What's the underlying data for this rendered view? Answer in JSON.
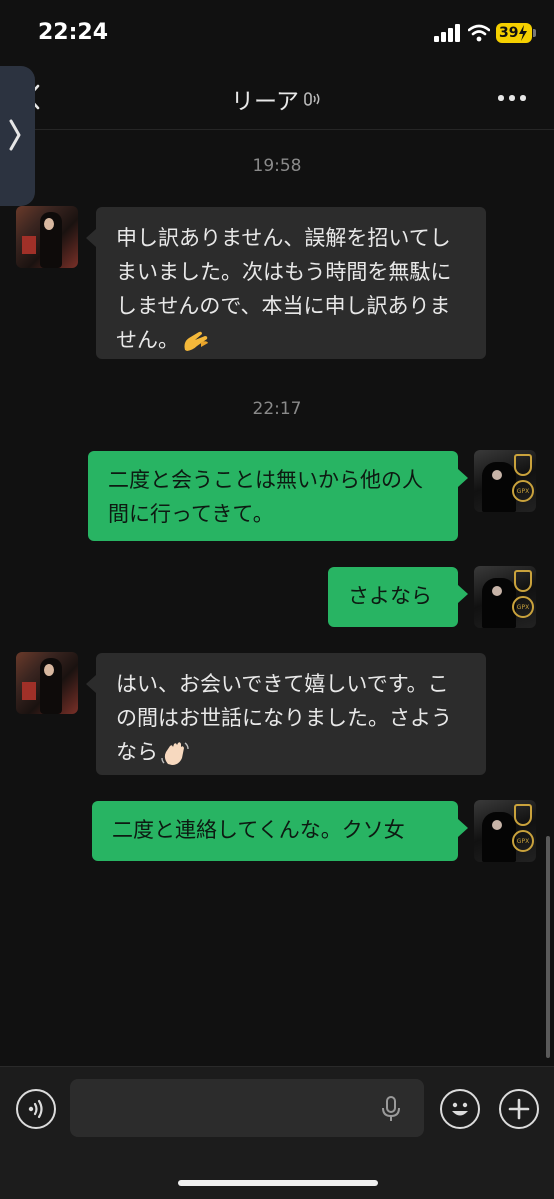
{
  "status_bar": {
    "time": "22:24",
    "battery": "39"
  },
  "header": {
    "title": "リーア"
  },
  "messages": [
    {
      "type": "timestamp",
      "text": "19:58"
    },
    {
      "type": "incoming",
      "text": "申し訳ありません、誤解を招いてしまいました。次はもう時間を無駄にしませんので、本当に申し訳ありません。",
      "emoji": "pinching-hand-emoji"
    },
    {
      "type": "timestamp",
      "text": "22:17"
    },
    {
      "type": "outgoing",
      "text": "二度と会うことは無いから他の人間に行ってきて。"
    },
    {
      "type": "outgoing",
      "text": "さよなら"
    },
    {
      "type": "incoming",
      "text": "はい、お会いできて嬉しいです。この間はお世話になりました。さようなら",
      "emoji": "waving-hand-emoji"
    },
    {
      "type": "outgoing",
      "text": "二度と連絡してくんな。クソ女"
    }
  ],
  "input": {
    "placeholder": ""
  },
  "colors": {
    "outgoing_bubble": "#28b463",
    "incoming_bubble": "#2c2c2c",
    "background": "#111111"
  }
}
